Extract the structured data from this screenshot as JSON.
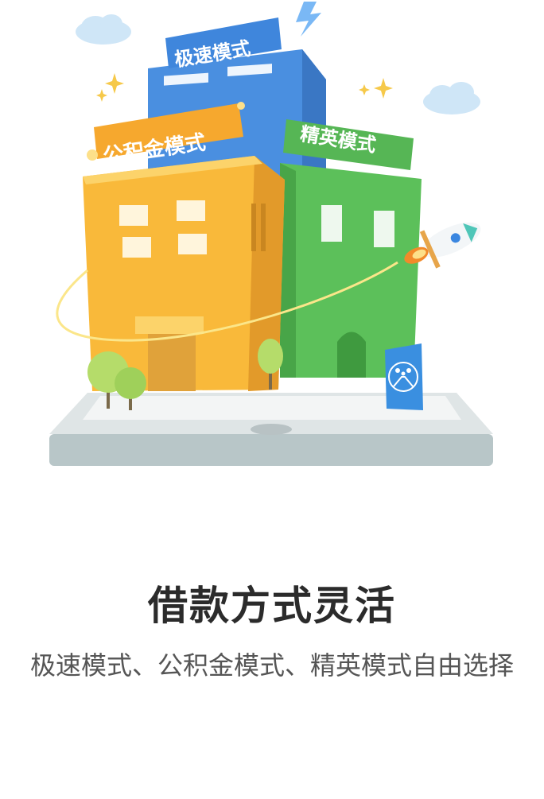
{
  "illustration": {
    "signs": {
      "fast": "极速模式",
      "fund": "公积金模式",
      "elite": "精英模式"
    },
    "icons": [
      "cloud-icon",
      "lightning-icon",
      "sparkle-icon",
      "rocket-icon",
      "family-icon",
      "tree-icon"
    ]
  },
  "page": {
    "title": "借款方式灵活",
    "subtitle": "极速模式、公积金模式、精英模式自由选择"
  },
  "colors": {
    "blue_building": "#4a8fe0",
    "yellow_building": "#f9b93a",
    "green_building": "#5cc05a",
    "platform": "#e6eaeb",
    "title": "#2b2b2b",
    "subtitle": "#555555"
  }
}
